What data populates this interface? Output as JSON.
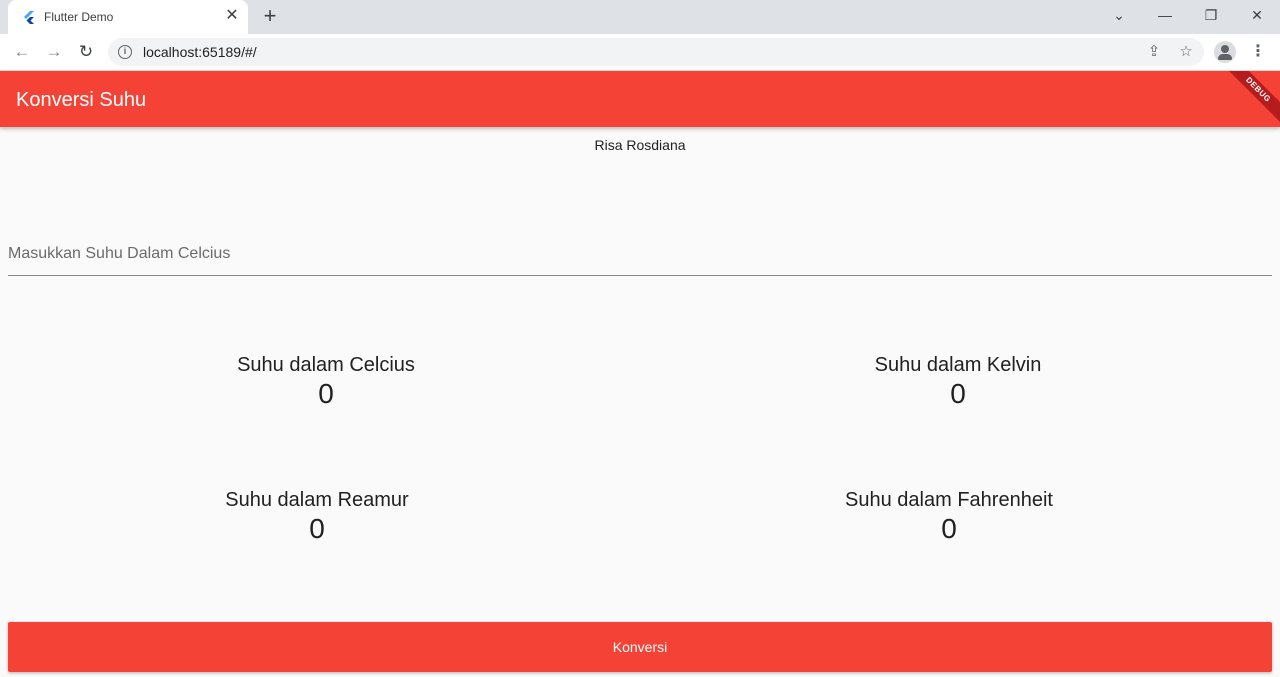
{
  "browser": {
    "tab_title": "Flutter Demo",
    "url": "localhost:65189/#/"
  },
  "app": {
    "title": "Konversi Suhu",
    "debug_label": "DEBUG",
    "accent_color": "#f44336",
    "author": "Risa Rosdiana",
    "input_placeholder": "Masukkan Suhu Dalam Celcius",
    "input_value": "",
    "results": {
      "celcius": {
        "label": "Suhu dalam Celcius",
        "value": "0"
      },
      "kelvin": {
        "label": "Suhu dalam Kelvin",
        "value": "0"
      },
      "reamur": {
        "label": "Suhu dalam Reamur",
        "value": "0"
      },
      "fahrenheit": {
        "label": "Suhu dalam Fahrenheit",
        "value": "0"
      }
    },
    "button_label": "Konversi"
  }
}
